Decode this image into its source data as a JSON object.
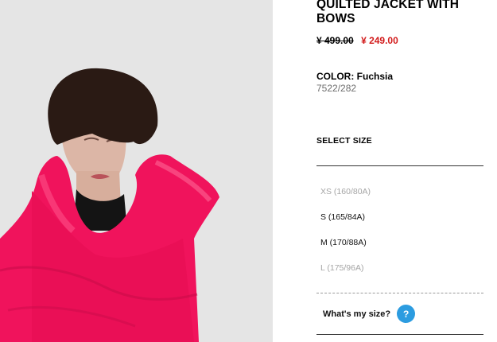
{
  "product": {
    "title": "QUILTED JACKET WITH BOWS",
    "price_old": "¥ 499.00",
    "price_new": "¥ 249.00",
    "color_label": "COLOR: Fuchsia",
    "reference": "7522/282",
    "image_alt": "product-photo-model-fuchsia-jacket"
  },
  "sizes": {
    "heading": "SELECT SIZE",
    "options": [
      {
        "label": "XS (160/80A)",
        "available": false
      },
      {
        "label": "S (165/84A)",
        "available": true
      },
      {
        "label": "M (170/88A)",
        "available": true
      },
      {
        "label": "L (175/96A)",
        "available": false
      }
    ]
  },
  "help": {
    "label": "What's my size?",
    "icon_glyph": "?"
  },
  "colors": {
    "sale_price": "#d21b1b",
    "jacket": "#f0135c",
    "help_icon": "#2c9ce0",
    "unavailable_text": "#a5a5a5"
  }
}
